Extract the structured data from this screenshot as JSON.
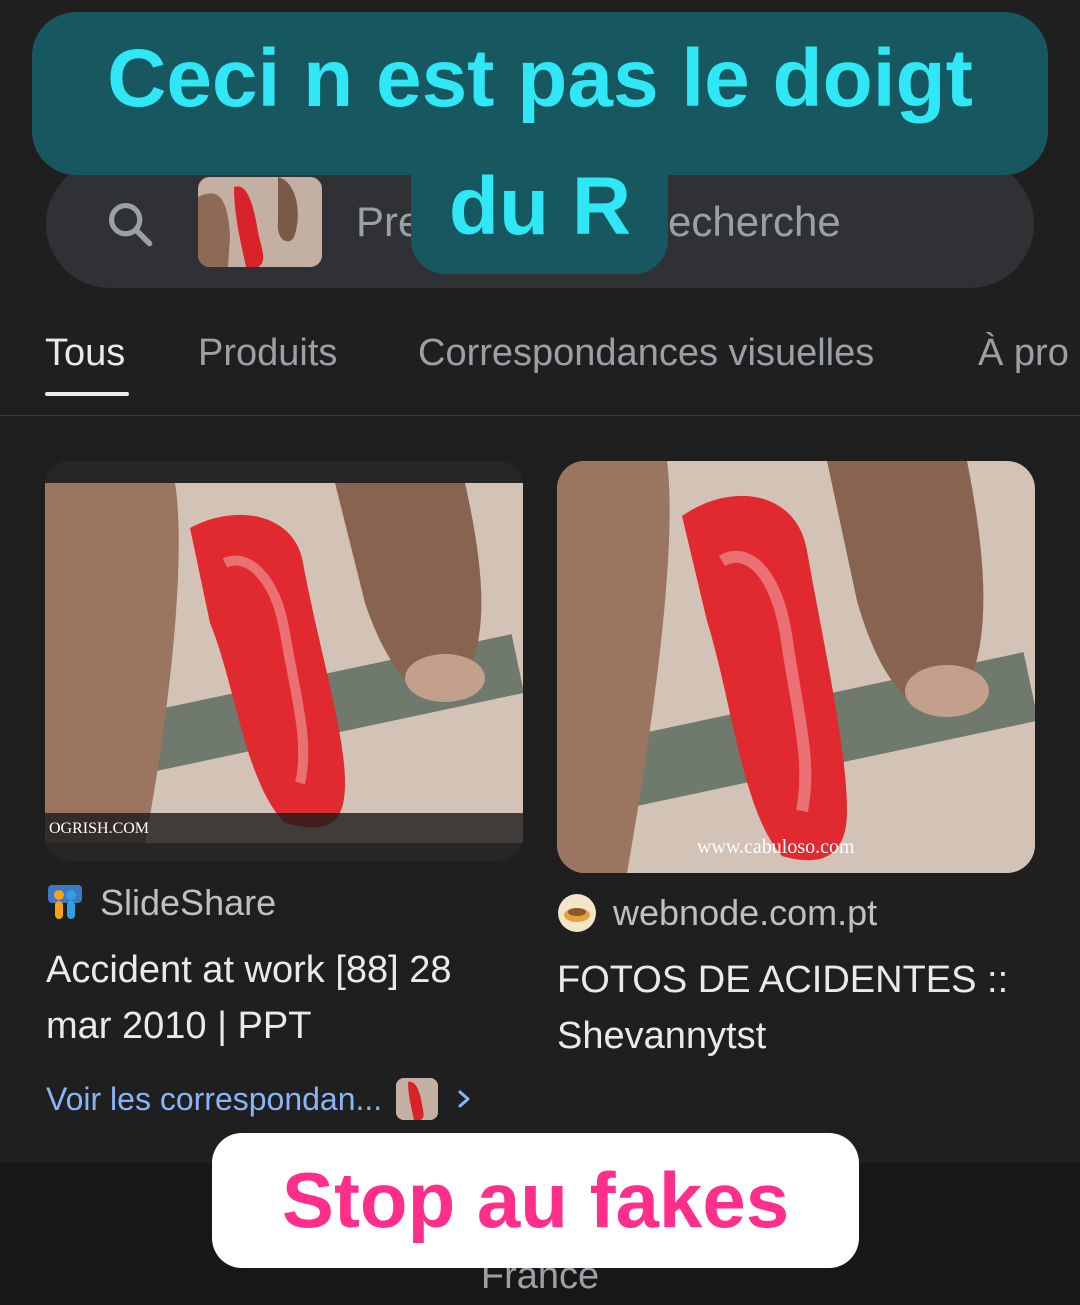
{
  "overlay": {
    "top_line1": "Ceci n est pas le doigt",
    "top_line2": "du R",
    "bottom": "Stop au fakes",
    "top_color": "#17575f",
    "top_text_color": "#2fe7f5",
    "bottom_text_color": "#ff2e8b"
  },
  "search": {
    "icon": "search-icon",
    "placeholder_visible_left": "Pre",
    "placeholder_visible_right": "echerche"
  },
  "tabs": [
    {
      "label": "Tous",
      "active": true
    },
    {
      "label": "Produits",
      "active": false
    },
    {
      "label": "Correspondances visuelles",
      "active": false
    },
    {
      "label": "À pro",
      "active": false
    }
  ],
  "results": [
    {
      "source": "SlideShare",
      "title": "Accident at work [88] 28 mar 2010 | PPT",
      "watermark": "OGRISH.COM"
    },
    {
      "source": "webnode.com.pt",
      "title": "FOTOS DE ACIDENTES :: Shevannytst",
      "watermark": "www.cabuloso.com"
    }
  ],
  "more_matches": {
    "label": "Voir les correspondan...",
    "chevron": "chevron-right-icon"
  },
  "footer": {
    "text": "France"
  }
}
